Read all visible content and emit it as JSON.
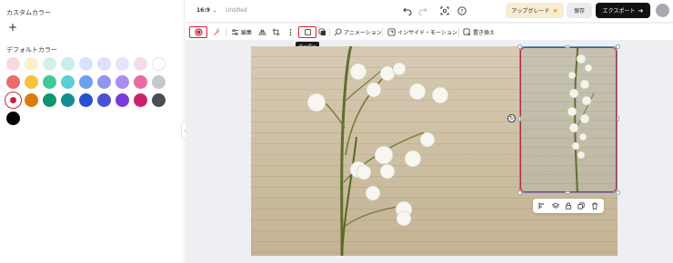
{
  "left_panel": {
    "custom_color_label": "カスタムカラー",
    "add_label": "+",
    "default_color_label": "デフォルトカラー",
    "swatches": [
      "#f9d9dc",
      "#fdf0c6",
      "#d3f1e5",
      "#c8eeee",
      "#d6e4fb",
      "#dfe1fb",
      "#e8e1fb",
      "#f5dbea",
      "#ffffff",
      "#ec6b6b",
      "#f7c33c",
      "#3bcb9b",
      "#5bd0d4",
      "#6b9ef2",
      "#8f96f0",
      "#ad8cf3",
      "#ea6aa6",
      "#c6c7ca",
      "#c4243d",
      "#da7c0c",
      "#10946c",
      "#128e93",
      "#2550d4",
      "#4e4fd8",
      "#7c3adb",
      "#c8236a",
      "#4b4e54",
      "#000000"
    ],
    "selected_swatch_color": "#c4243d"
  },
  "top_bar": {
    "ratio": "16:9",
    "doc_title": "Untitled",
    "icons": [
      "undo-icon",
      "redo-icon",
      "screen-capture-icon",
      "help-icon"
    ],
    "upgrade_label": "アップグレード",
    "upgrade_icon": "star-icon",
    "save_label": "保存",
    "export_label": "エクスポート",
    "export_icon": "arrow-right-icon"
  },
  "edit_bar": {
    "edit_label": "編集",
    "border_tooltip": "ボーダー",
    "animation_label": "アニメーション",
    "inside_motion_label": "インサイド・モーション",
    "replace_label": "置き換え"
  },
  "colors": {
    "accent_red": "#e21b2c",
    "border_red": "#c4243d",
    "export_bg": "#111111",
    "upgrade_bg": "#f8ecd3"
  }
}
